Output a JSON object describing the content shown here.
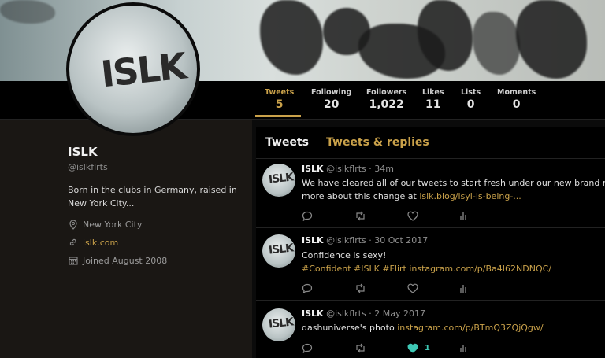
{
  "profile": {
    "name": "ISLK",
    "handle": "@islkflrts",
    "bio": "Born in the clubs in Germany, raised in New York City...",
    "location": "New York City",
    "website": "islk.com",
    "joined": "Joined August 2008",
    "avatar_text": "ISLK"
  },
  "stats": [
    {
      "label": "Tweets",
      "value": "5"
    },
    {
      "label": "Following",
      "value": "20"
    },
    {
      "label": "Followers",
      "value": "1,022"
    },
    {
      "label": "Likes",
      "value": "11"
    },
    {
      "label": "Lists",
      "value": "0"
    },
    {
      "label": "Moments",
      "value": "0"
    }
  ],
  "tabs": {
    "tweets": "Tweets",
    "replies": "Tweets & replies"
  },
  "tweets": [
    {
      "name": "ISLK",
      "handle": "@islkflrts",
      "time": "· 34m",
      "line1": "We have cleared all of our tweets to start fresh under our new brand name!",
      "line2_text": "more about this change at ",
      "line2_link": "islk.blog/isyl-is-being-...",
      "likes": ""
    },
    {
      "name": "ISLK",
      "handle": "@islkflrts",
      "time": "· 30 Oct 2017",
      "line1": "Confidence is sexy!",
      "line2_link": "#Confident #ISLK #Flirt instagram.com/p/Ba4I62NDNQC/",
      "likes": ""
    },
    {
      "name": "ISLK",
      "handle": "@islkflrts",
      "time": "· 2 May 2017",
      "line1_text": "dashuniverse's photo ",
      "line1_link": "instagram.com/p/BTmQ3ZQjQgw/",
      "likes": "1"
    }
  ],
  "colors": {
    "accent": "#c9a14a",
    "liked": "#3ec8b5",
    "sidebar_bg": "#1a1714"
  },
  "icons": [
    "location-icon",
    "link-icon",
    "calendar-icon",
    "reply-icon",
    "retweet-icon",
    "like-icon",
    "analytics-icon"
  ]
}
